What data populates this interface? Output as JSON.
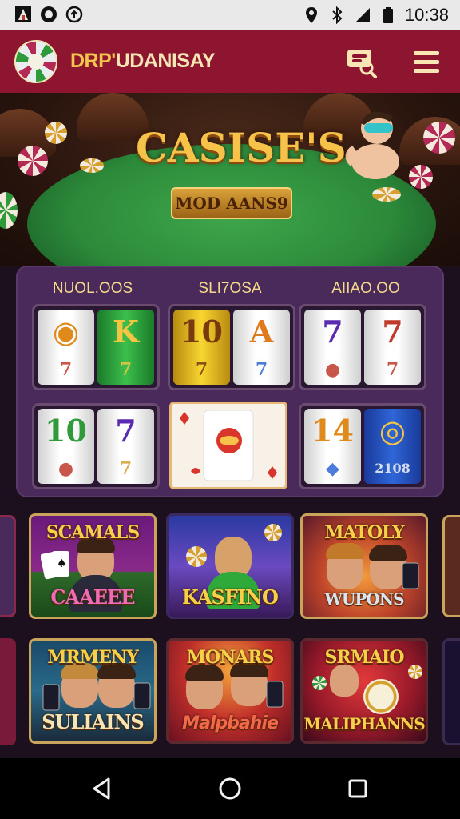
{
  "status_bar": {
    "time": "10:38",
    "icons": [
      "app-icon",
      "notification-icon",
      "sync-icon",
      "location-icon",
      "bluetooth-icon",
      "signal-icon",
      "battery-icon"
    ]
  },
  "app_bar": {
    "brand_prefix": "DRP'",
    "brand_rest": "UDANISAY",
    "icons": [
      "roulette-logo-icon",
      "chat-search-icon",
      "menu-icon"
    ],
    "colors": {
      "background": "#8e1530",
      "brand_text": "#f7e6b4"
    }
  },
  "hero": {
    "title_line1": "CASISE'S",
    "subtitle": "MOD AANS9"
  },
  "reels": {
    "columns": [
      "NUOL.OOS",
      "SLI7OSA",
      "AIIAO.OO"
    ],
    "rows": [
      [
        {
          "strips": [
            {
              "style": "white",
              "symbols": [
                "◉",
                "7"
              ]
            },
            {
              "style": "green",
              "symbols": [
                "K",
                "7"
              ]
            }
          ]
        },
        {
          "strips": [
            {
              "style": "yellow",
              "symbols": [
                "10",
                "7"
              ]
            },
            {
              "style": "white",
              "symbols": [
                "A",
                "7"
              ]
            }
          ]
        },
        {
          "strips": [
            {
              "style": "white",
              "symbols": [
                "7",
                "●"
              ]
            },
            {
              "style": "white",
              "symbols": [
                "7",
                "7"
              ]
            }
          ]
        }
      ],
      [
        {
          "strips": [
            {
              "style": "white",
              "symbols": [
                "10",
                "●"
              ]
            },
            {
              "style": "white",
              "symbols": [
                "7",
                "7"
              ]
            }
          ]
        },
        {
          "card": true
        },
        {
          "strips": [
            {
              "style": "white",
              "symbols": [
                "14",
                "◆"
              ]
            },
            {
              "style": "blue",
              "symbols": [
                "◎",
                "2108"
              ]
            }
          ]
        }
      ]
    ]
  },
  "tiles": [
    {
      "top": "SCAMALS",
      "bottom": "CAAEEE"
    },
    {
      "top": "",
      "bottom": "KASFINO"
    },
    {
      "top": "MATOLY",
      "bottom": "WUPONS"
    },
    {
      "top": "MRMENY",
      "bottom": "SULIAINS"
    },
    {
      "top": "MONARS",
      "bottom": "Malpbahie"
    },
    {
      "top": "SRMAIO",
      "bottom": "MALIPHANNS"
    }
  ],
  "nav_bar": {
    "icons": [
      "back-icon",
      "home-icon",
      "recents-icon"
    ]
  }
}
